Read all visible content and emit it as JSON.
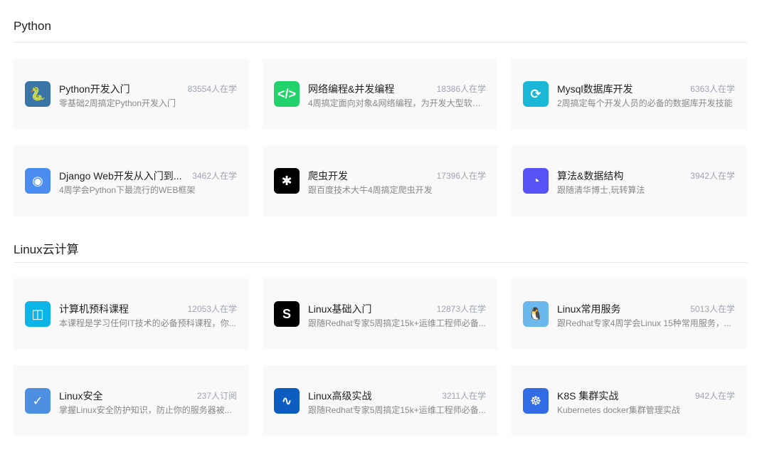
{
  "sections": [
    {
      "title": "Python",
      "courses": [
        {
          "title": "Python开发入门",
          "count": "83554人在学",
          "desc": "零基础2周搞定Python开发入门",
          "icon": "python-icon",
          "color": "#3a75a8",
          "glyph": "🐍"
        },
        {
          "title": "网络编程&并发编程",
          "count": "18386人在学",
          "desc": "4周搞定面向对象&网络编程，为开发大型软件...",
          "icon": "code-monitor-icon",
          "color": "#22d36b",
          "glyph": "</>"
        },
        {
          "title": "Mysql数据库开发",
          "count": "6363人在学",
          "desc": "2周搞定每个开发人员的必备的数据库开发技能",
          "icon": "database-icon",
          "color": "#1ab8d6",
          "glyph": "⟳"
        },
        {
          "title": "Django Web开发从入门到...",
          "count": "3462人在学",
          "desc": "4周学会Python下最流行的WEB框架",
          "icon": "web-globe-icon",
          "color": "#4a8cf0",
          "glyph": "◉"
        },
        {
          "title": "爬虫开发",
          "count": "17396人在学",
          "desc": "跟百度技术大牛4周搞定爬虫开发",
          "icon": "bug-icon",
          "color": "#000000",
          "glyph": "✱"
        },
        {
          "title": "算法&数据结构",
          "count": "3942人在学",
          "desc": "跟随清华博士,玩转算法",
          "icon": "pie-chart-icon",
          "color": "#5553f5",
          "glyph": "◔"
        }
      ]
    },
    {
      "title": "Linux云计算",
      "courses": [
        {
          "title": "计算机预科课程",
          "count": "12053人在学",
          "desc": "本课程是学习任何IT技术的必备预科课程，你...",
          "icon": "computer-icon",
          "color": "#0db4e6",
          "glyph": "◫"
        },
        {
          "title": "Linux基础入门",
          "count": "12873人在学",
          "desc": "跟随Redhat专家5周搞定15k+运维工程师必备...",
          "icon": "s-logo-icon",
          "color": "#000000",
          "glyph": "S"
        },
        {
          "title": "Linux常用服务",
          "count": "5013人在学",
          "desc": "跟Redhat专家4周学会Linux 15种常用服务，...",
          "icon": "penguin-icon",
          "color": "#6ab8ec",
          "glyph": "🐧"
        },
        {
          "title": "Linux安全",
          "count": "237人订阅",
          "desc": "掌握Linux安全防护知识，防止你的服务器被...",
          "icon": "shield-icon",
          "color": "#4d8fe0",
          "glyph": "✓"
        },
        {
          "title": "Linux高级实战",
          "count": "3211人在学",
          "desc": "跟随Redhat专家5周搞定15k+运维工程师必备...",
          "icon": "monitor-pulse-icon",
          "color": "#0d5cbf",
          "glyph": "∿"
        },
        {
          "title": "K8S 集群实战",
          "count": "942人在学",
          "desc": "Kubernetes docker集群管理实战",
          "icon": "kubernetes-icon",
          "color": "#326ce5",
          "glyph": "☸"
        }
      ]
    }
  ]
}
